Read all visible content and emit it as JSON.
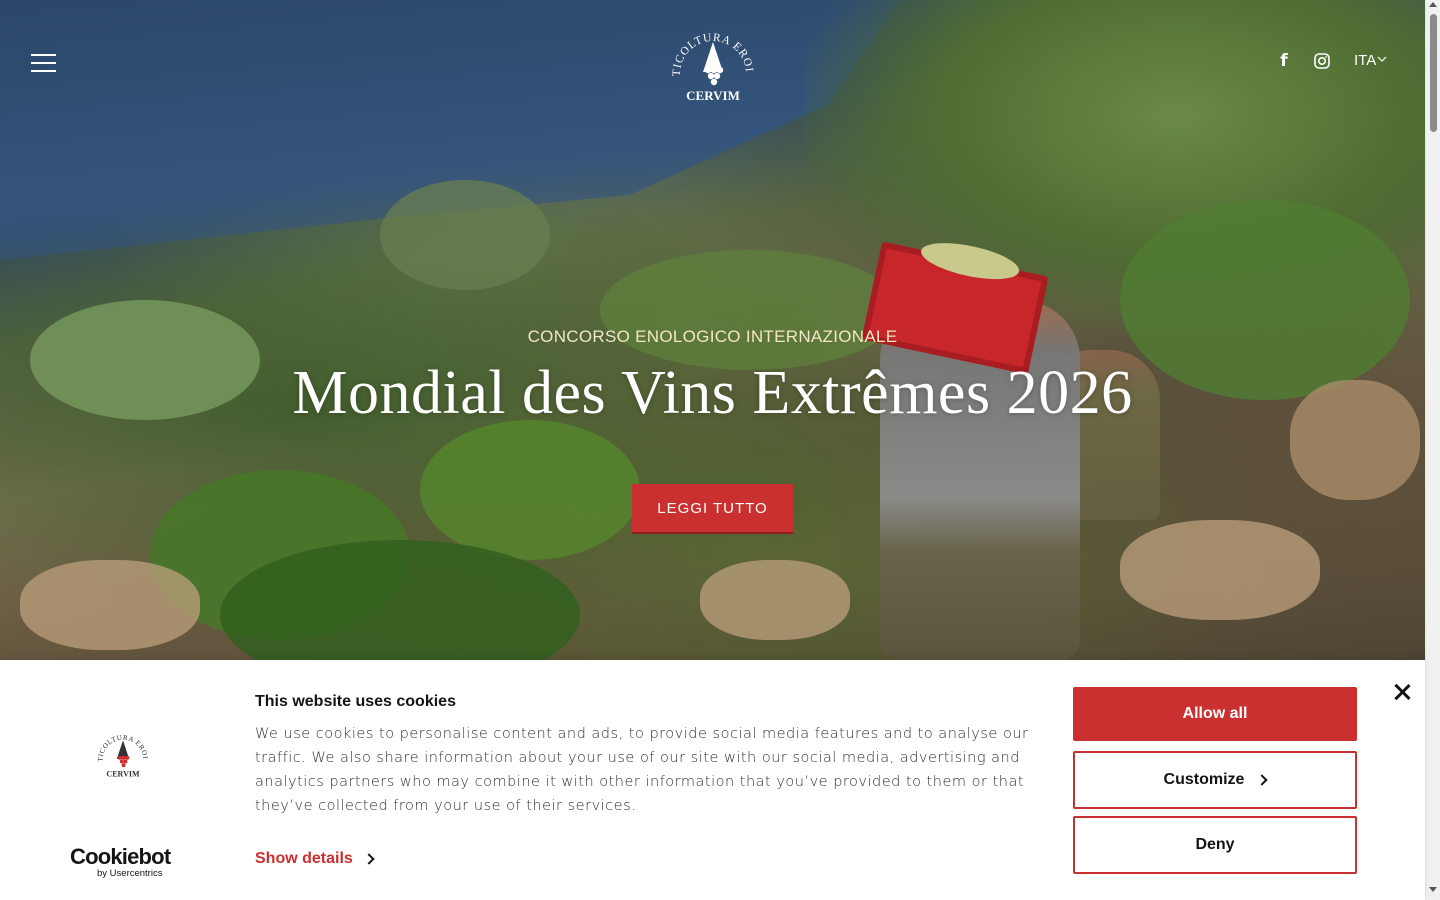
{
  "header": {
    "menu_icon": "hamburger-icon",
    "logo_text_arc": "VITICOLTURA EROICA",
    "logo_text_bottom": "CERVIM",
    "social": [
      {
        "name": "facebook-icon",
        "glyph": "f"
      },
      {
        "name": "instagram-icon"
      }
    ],
    "language": "ITA",
    "language_icon": "chevron-down-icon"
  },
  "hero": {
    "kicker": "CONCORSO ENOLOGICO INTERNAZIONALE",
    "title": "Mondial des Vins Extrêmes 2026",
    "cta_label": "LEGGI TUTTO"
  },
  "cookie_banner": {
    "title": "This website uses cookies",
    "body": "We use cookies to personalise content and ads, to provide social media features and to analyse our traffic. We also share information about your use of our site with our social media, advertising and analytics partners who may combine it with other information that you’ve provided to them or that they’ve collected from your use of their services.",
    "show_details": "Show details",
    "allow_all": "Allow all",
    "customize": "Customize",
    "deny": "Deny",
    "provider_name": "Cookiebot",
    "provider_by": "by Usercentrics",
    "logo_text_arc": "VITICOLTURA EROICA",
    "logo_text_bottom": "CERVIM"
  },
  "colors": {
    "accent": "#c9302f",
    "kicker": "#f1e7c5",
    "text_dark": "#141414"
  }
}
